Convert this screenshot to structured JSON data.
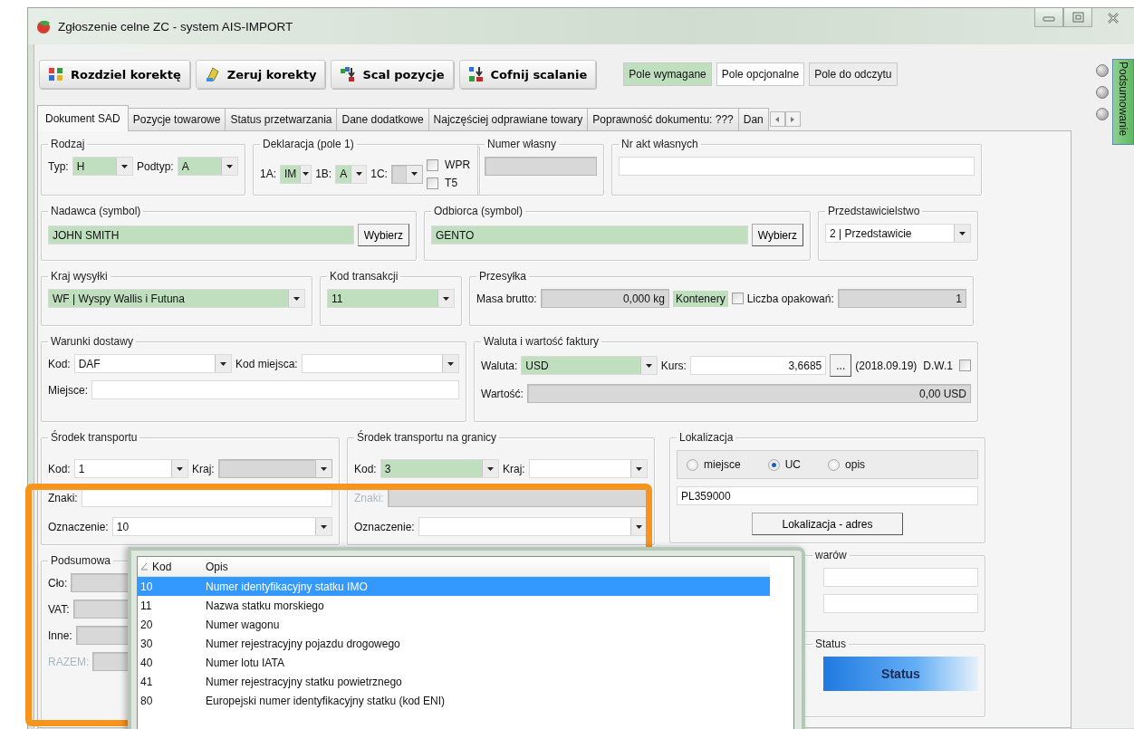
{
  "window": {
    "title": "Zgłoszenie celne ZC - system AIS-IMPORT"
  },
  "toolbar": {
    "buttons": [
      {
        "label": "Rozdziel korektę",
        "kind": "split"
      },
      {
        "label": "Zeruj korekty",
        "kind": "reset"
      },
      {
        "label": "Scal pozycje",
        "kind": "merge"
      },
      {
        "label": "Cofnij scalanie",
        "kind": "unmerge"
      }
    ],
    "legend": [
      {
        "label": "Pole wymagane",
        "kind": "required"
      },
      {
        "label": "Pole opcjonalne",
        "kind": "optional"
      },
      {
        "label": "Pole do odczytu",
        "kind": "readonly"
      }
    ]
  },
  "tabs": [
    {
      "label": "Dokument SAD",
      "selected": true
    },
    {
      "label": "Pozycje towarowe",
      "selected": false
    },
    {
      "label": "Status przetwarzania",
      "selected": false
    },
    {
      "label": "Dane dodatkowe",
      "selected": false
    },
    {
      "label": "Najczęściej odprawiane towary",
      "selected": false
    },
    {
      "label": "Poprawność dokumentu: ???",
      "selected": false
    },
    {
      "label": "Dan",
      "selected": false
    }
  ],
  "form": {
    "lines": [
      [
        {
          "title": "Rodzaj",
          "rows": [
            [
              {
                "kind": "combo",
                "label": "Typ:",
                "value": "H",
                "required": true,
                "readonly": false
              },
              {
                "kind": "combo",
                "label": "Podtyp:",
                "value": "A",
                "required": true,
                "readonly": false
              }
            ]
          ]
        },
        {
          "title": "Deklaracja (pole 1)",
          "rows": [
            [
              {
                "kind": "combo",
                "label": "1A:",
                "value": "IM",
                "required": true,
                "readonly": false
              },
              {
                "kind": "combo",
                "label": "1B:",
                "value": "A",
                "required": true,
                "readonly": false
              },
              {
                "kind": "combo",
                "label": "1C:",
                "required": false,
                "readonly": true
              },
              {
                "kind": "stack",
                "items": [
                  {
                    "kind": "check",
                    "label": "WPR",
                    "checked": false
                  },
                  {
                    "kind": "check",
                    "label": "T5",
                    "checked": false
                  }
                ]
              }
            ]
          ]
        },
        {
          "title": "Numer własny",
          "rows": [
            [
              {
                "kind": "input",
                "required": false,
                "readonly": true
              }
            ]
          ]
        },
        {
          "title": "Nr akt własnych",
          "rows": [
            [
              {
                "kind": "input",
                "required": false,
                "readonly": false
              }
            ]
          ]
        }
      ],
      [
        {
          "title": "Nadawca (symbol)",
          "rows": [
            [
              {
                "kind": "input",
                "value": "JOHN SMITH",
                "required": true,
                "readonly": false
              },
              {
                "kind": "button",
                "label": "Wybierz"
              }
            ]
          ]
        },
        {
          "title": "Odbiorca (symbol)",
          "rows": [
            [
              {
                "kind": "input",
                "value": "GENTO",
                "required": true,
                "readonly": false
              },
              {
                "kind": "button",
                "label": "Wybierz"
              }
            ]
          ]
        },
        {
          "title": "Przedstawicielstwo",
          "rows": [
            [
              {
                "kind": "combo",
                "value": "2 | Przedstawicie",
                "required": false,
                "readonly": false
              }
            ]
          ]
        }
      ],
      [
        {
          "title": "Kraj wysyłki",
          "rows": [
            [
              {
                "kind": "combo",
                "value": "WF | Wyspy Wallis i Futuna",
                "required": true,
                "readonly": false
              }
            ]
          ]
        },
        {
          "title": "Kod transakcji",
          "rows": [
            [
              {
                "kind": "combo",
                "value": "11",
                "required": true,
                "readonly": false
              }
            ]
          ]
        },
        {
          "title": "Przesyłka",
          "rows": [
            [
              {
                "kind": "input",
                "label": "Masa brutto:",
                "value": "0,000 kg",
                "required": false,
                "readonly": true,
                "numeric": true
              },
              {
                "kind": "check",
                "label": "Kontenery",
                "checked": false,
                "required": true
              },
              {
                "kind": "input",
                "label": "Liczba opakowań:",
                "value": "1",
                "required": false,
                "readonly": true,
                "numeric": true
              }
            ]
          ]
        }
      ],
      [
        {
          "title": "Warunki dostawy",
          "rows": [
            [
              {
                "kind": "combo",
                "label": "Kod:",
                "value": "DAF",
                "required": false,
                "readonly": false
              },
              {
                "kind": "combo",
                "label": "Kod miejsca:",
                "required": false,
                "readonly": false
              }
            ],
            [
              {
                "kind": "input",
                "label": "Miejsce:",
                "required": false,
                "readonly": false
              }
            ]
          ]
        },
        {
          "title": "Waluta i wartość faktury",
          "rows": [
            [
              {
                "kind": "combo",
                "label": "Waluta:",
                "value": "USD",
                "required": true,
                "readonly": false
              },
              {
                "kind": "input",
                "label": "Kurs:",
                "value": "3,6685",
                "required": false,
                "readonly": false,
                "numeric": true
              },
              {
                "kind": "button",
                "label": "..."
              },
              {
                "kind": "text",
                "label": "(2018.09.19)"
              },
              {
                "kind": "check",
                "label": "D.W.1",
                "checked": false
              }
            ],
            [
              {
                "kind": "input",
                "label": "Wartość:",
                "value": "0,00 USD",
                "required": false,
                "readonly": true,
                "numeric": true
              }
            ]
          ]
        }
      ]
    ],
    "bottom_left": [
      {
        "title": "Środek transportu",
        "rows": [
          [
            {
              "kind": "combo",
              "label": "Kod:",
              "value": "1",
              "required": false,
              "readonly": false
            },
            {
              "kind": "combo",
              "label": "Kraj:",
              "required": false,
              "readonly": true
            }
          ],
          [
            {
              "kind": "input",
              "label": "Znaki:",
              "required": false,
              "readonly": false
            }
          ],
          [
            {
              "kind": "combo",
              "label": "Oznaczenie:",
              "value": "10",
              "required": false,
              "readonly": false
            }
          ]
        ]
      },
      {
        "title": "Środek transportu na granicy",
        "rows": [
          [
            {
              "kind": "combo",
              "label": "Kod:",
              "value": "3",
              "required": true,
              "readonly": false
            },
            {
              "kind": "combo",
              "label": "Kraj:",
              "required": false,
              "readonly": false
            }
          ],
          [
            {
              "kind": "input",
              "label": "Znaki:",
              "required": false,
              "readonly": true,
              "disabled": true
            }
          ],
          [
            {
              "kind": "combo",
              "label": "Oznaczenie:",
              "required": false,
              "readonly": false
            }
          ]
        ]
      }
    ],
    "summary": {
      "title": "Podsumowa",
      "rows": [
        [
          {
            "kind": "input",
            "label": "Cło:",
            "required": false,
            "readonly": true
          }
        ],
        [
          {
            "kind": "input",
            "label": "VAT:",
            "required": false,
            "readonly": true
          }
        ],
        [
          {
            "kind": "input",
            "label": "Inne:",
            "required": false,
            "readonly": true
          }
        ],
        [
          {
            "kind": "input",
            "label": "RAZEM:",
            "required": false,
            "readonly": true,
            "disabled": true
          }
        ]
      ]
    },
    "bottom_right": [
      {
        "title": "Lokalizacja",
        "rows": [
          [
            {
              "kind": "radios",
              "items": [
                {
                  "label": "miejsce",
                  "selected": false
                },
                {
                  "label": "UC",
                  "selected": true
                },
                {
                  "label": "opis",
                  "selected": false
                }
              ]
            }
          ],
          [
            {
              "kind": "input",
              "value": "PL359000",
              "required": false,
              "readonly": false
            }
          ],
          [
            {
              "kind": "button",
              "label": "Lokalizacja - adres"
            }
          ]
        ]
      },
      {
        "title": "warów",
        "rows": [
          [
            {
              "kind": "input",
              "required": false,
              "readonly": false
            }
          ],
          [
            {
              "kind": "input",
              "required": false,
              "readonly": false
            }
          ]
        ]
      },
      {
        "title": "Status",
        "rows": [
          [
            {
              "kind": "status",
              "label": "Status"
            }
          ]
        ]
      }
    ]
  },
  "code_popup": {
    "columns": [
      {
        "label": "Kod",
        "sorted": true
      },
      {
        "label": "Opis",
        "sorted": false
      }
    ],
    "rows": [
      {
        "code": "10",
        "description": "Numer identyfikacyjny statku IMO",
        "selected": true
      },
      {
        "code": "11",
        "description": "Nazwa statku morskiego",
        "selected": false
      },
      {
        "code": "20",
        "description": "Numer wagonu",
        "selected": false
      },
      {
        "code": "30",
        "description": "Numer rejestracyjny pojazdu drogowego",
        "selected": false
      },
      {
        "code": "40",
        "description": "Numer lotu IATA",
        "selected": false
      },
      {
        "code": "41",
        "description": "Numer rejestracyjny statku powietrznego",
        "selected": false
      },
      {
        "code": "80",
        "description": "Europejski numer identyfikacyjny statku (kod ENI)",
        "selected": false
      }
    ]
  },
  "side_tab": {
    "label": "Podsumowanie"
  }
}
